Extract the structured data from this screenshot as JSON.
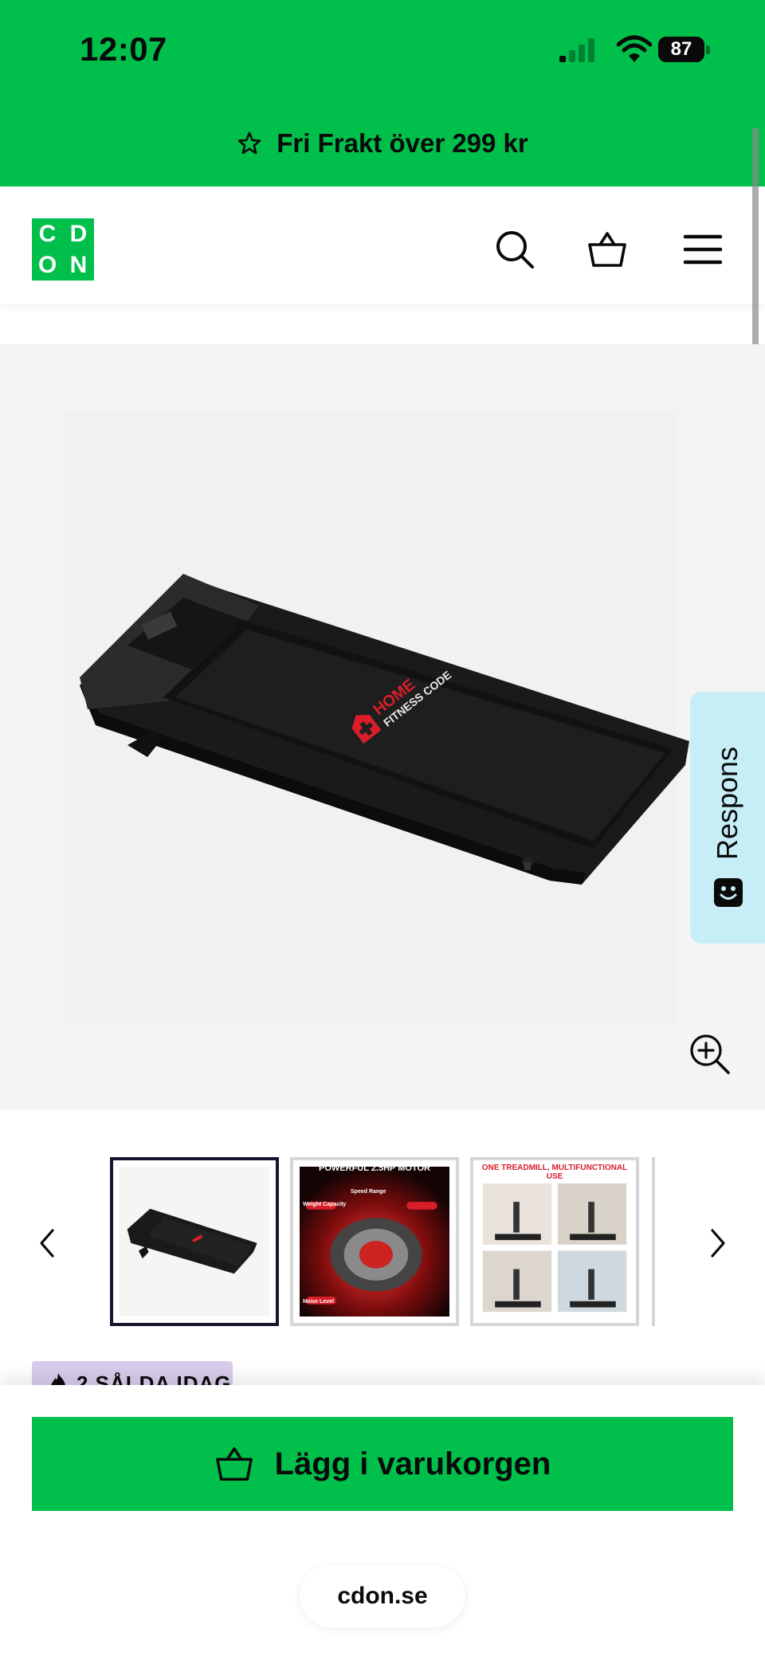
{
  "status_bar": {
    "time": "12:07",
    "battery": "87"
  },
  "promo": {
    "text": "Fri Frakt över 299 kr",
    "icon": "star-icon"
  },
  "header": {
    "logo_letters": [
      "C",
      "D",
      "O",
      "N"
    ],
    "icons": [
      "search-icon",
      "basket-icon",
      "hamburger-menu-icon"
    ]
  },
  "product_image": {
    "brand_top": "HOME",
    "brand_bottom": "FITNESS CODE"
  },
  "feedback_tab": {
    "label": "Respons",
    "icon": "smiley-icon"
  },
  "thumbnails": [
    {
      "title": "",
      "kind": "treadmill"
    },
    {
      "title": "POWERFUL 2.5HP MOTOR",
      "captions": [
        "Speed Range",
        "Weight Capacity",
        "Noise Level"
      ],
      "kind": "motor"
    },
    {
      "title": "ONE TREADMILL, MULTIFUNCTIONAL USE",
      "kind": "grid"
    }
  ],
  "badge": {
    "text": "2 SÅLDA IDAG",
    "icon": "fire-icon"
  },
  "cart_button": {
    "label": "Lägg i varukorgen",
    "icon": "basket-icon"
  },
  "browser": {
    "url": "cdon.se"
  },
  "colors": {
    "brand_green": "#00c04b",
    "feedback_bg": "#c7eef6",
    "badge_bg": "#d8ccec",
    "thumb_active_border": "#1a1330"
  }
}
